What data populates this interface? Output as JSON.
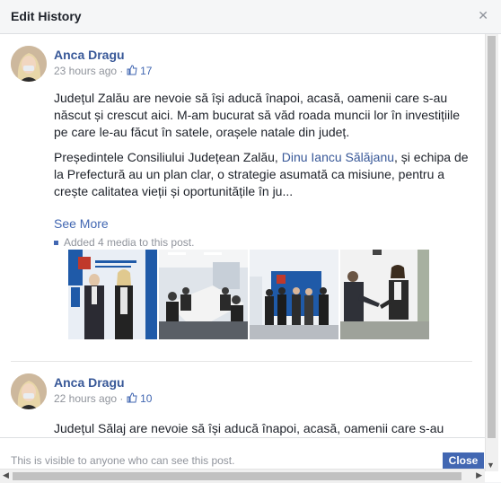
{
  "dialog": {
    "title": "Edit History"
  },
  "posts": [
    {
      "author": "Anca Dragu",
      "time": "23 hours ago",
      "separator": "·",
      "likes": "17",
      "paragraph1": "Județul Zalău are nevoie să își aducă înapoi, acasă, oamenii care s-au născut și crescut aici. M-am bucurat să văd roada muncii lor în investițiile pe care le-au făcut în satele, orașele natale din județ.",
      "paragraph2_before": "Președintele Consiliului Județean Zalău, ",
      "paragraph2_link": "Dinu Iancu Sălăjanu",
      "paragraph2_after": ", și echipa de la Prefectură au un plan clar, o strategie asumată ca misiune, pentru a crește calitatea vieții și oportunitățile în ju...",
      "see_more": "See More",
      "media_note": "Added 4 media to this post."
    },
    {
      "author": "Anca Dragu",
      "time": "22 hours ago",
      "separator": "·",
      "likes": "10",
      "paragraph1": "Județul Sălaj are nevoie să își aducă înapoi, acasă, oamenii care s-au"
    }
  ],
  "footer": {
    "note": "This is visible to anyone who can see this post.",
    "close_label": "Close"
  },
  "colors": {
    "link": "#385898",
    "accent": "#4267b2",
    "muted": "#90949c"
  },
  "icons": {
    "like": "thumbs-up-icon",
    "close": "close-icon"
  }
}
